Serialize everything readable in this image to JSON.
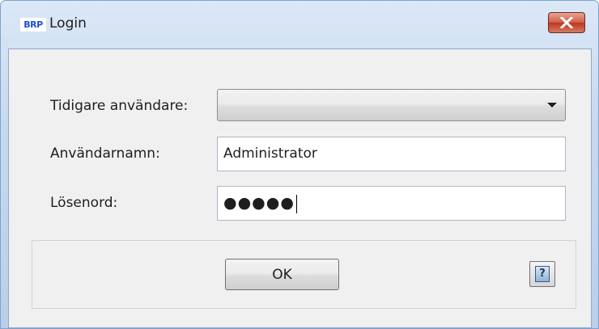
{
  "window": {
    "title": "Login",
    "app_icon_text": "BRP",
    "close_icon": "close-icon",
    "accent_color": "#c0351f"
  },
  "form": {
    "previous_user": {
      "label": "Tidigare användare:",
      "value": ""
    },
    "username": {
      "label": "Användarnamn:",
      "value": "Administrator"
    },
    "password": {
      "label": "Lösenord:",
      "masked_value": "●●●●●"
    }
  },
  "buttons": {
    "ok_label": "OK",
    "help_glyph": "?",
    "help_icon": "help-icon"
  }
}
